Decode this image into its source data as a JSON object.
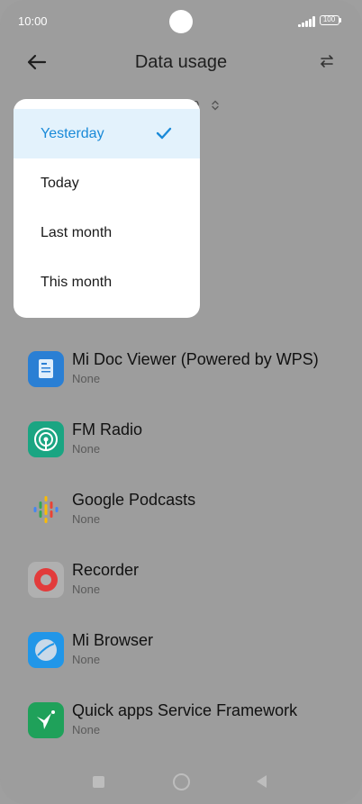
{
  "status": {
    "time": "10:00",
    "battery": "100"
  },
  "appbar": {
    "title": "Data usage"
  },
  "range": {
    "partial_label": "9"
  },
  "dropdown": {
    "items": [
      {
        "label": "Yesterday",
        "selected": true
      },
      {
        "label": "Today",
        "selected": false
      },
      {
        "label": "Last month",
        "selected": false
      },
      {
        "label": "This month",
        "selected": false
      }
    ]
  },
  "apps": [
    {
      "name": "Mi Doc Viewer (Powered by WPS)",
      "usage": "None",
      "icon": "doc-viewer-icon",
      "color": "#2a7fd4"
    },
    {
      "name": "FM Radio",
      "usage": "None",
      "icon": "fm-radio-icon",
      "color": "#1aa582"
    },
    {
      "name": "Google Podcasts",
      "usage": "None",
      "icon": "google-podcasts-icon",
      "color": "#ffffff"
    },
    {
      "name": "Recorder",
      "usage": "None",
      "icon": "recorder-icon",
      "color": "#e23b3b"
    },
    {
      "name": "Mi Browser",
      "usage": "None",
      "icon": "browser-icon",
      "color": "#2196e8"
    },
    {
      "name": "Quick apps Service Framework",
      "usage": "None",
      "icon": "quick-apps-icon",
      "color": "#1fa15a"
    }
  ]
}
